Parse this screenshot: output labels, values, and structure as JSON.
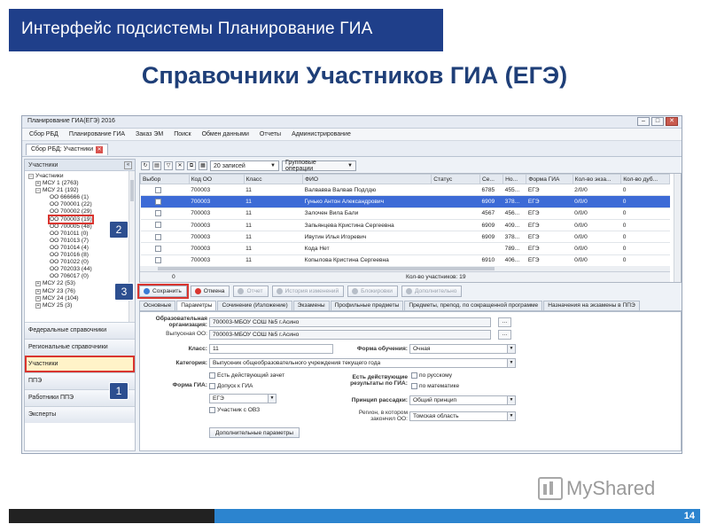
{
  "slide": {
    "banner": "Интерфейс подсистемы Планирование ГИА",
    "subtitle": "Справочники Участников ГИА (ЕГЭ)",
    "page_number": "14",
    "logo_text": "MyShared"
  },
  "window": {
    "title": "Планирование ГИА(ЕГЭ) 2016",
    "menu": [
      "Сбор РБД",
      "Планирование ГИА",
      "Заказ ЭМ",
      "Поиск",
      "Обмен данными",
      "Отчеты",
      "Администрирование"
    ],
    "doc_tab": "Сбор РБД: Участники"
  },
  "left_panel": {
    "header": "Участники",
    "tree": [
      {
        "label": "Участники",
        "level": 0,
        "exp": "−"
      },
      {
        "label": "МСУ 1 (2763)",
        "level": 1,
        "exp": "+"
      },
      {
        "label": "МСУ 21 (192)",
        "level": 1,
        "exp": "−"
      },
      {
        "label": "ОО 666666 (1)",
        "level": 2
      },
      {
        "label": "ОО 700001 (22)",
        "level": 2
      },
      {
        "label": "ОО 700002 (29)",
        "level": 2
      },
      {
        "label": "ОО 700003 (19)",
        "level": 2
      },
      {
        "label": "ОО 700005 (48)",
        "level": 2
      },
      {
        "label": "ОО 701011 (0)",
        "level": 2
      },
      {
        "label": "ОО 701013 (7)",
        "level": 2
      },
      {
        "label": "ОО 701014 (4)",
        "level": 2
      },
      {
        "label": "ОО 701016 (8)",
        "level": 2
      },
      {
        "label": "ОО 701022 (0)",
        "level": 2
      },
      {
        "label": "ОО 702033 (44)",
        "level": 2
      },
      {
        "label": "ОО 706017 (0)",
        "level": 2
      },
      {
        "label": "МСУ 22 (53)",
        "level": 1,
        "exp": "+"
      },
      {
        "label": "МСУ 23 (76)",
        "level": 1,
        "exp": "+"
      },
      {
        "label": "МСУ 24 (104)",
        "level": 1,
        "exp": "+"
      },
      {
        "label": "МСУ 25 (3)",
        "level": 1,
        "exp": "+"
      }
    ],
    "nav": [
      "Федеральные справочники",
      "Региональные справочники",
      "Участники",
      "ППЭ",
      "Работники ППЭ",
      "Эксперты"
    ]
  },
  "toolbar": {
    "records_combo": "20 записей",
    "group_ops": "Групповые операции"
  },
  "grid": {
    "columns": [
      "Выбор",
      "Код ОО",
      "Класс",
      "ФИО",
      "Статус",
      "Се...",
      "Но...",
      "Форма ГИА",
      "Кол-во экза...",
      "Кол-во дуб..."
    ],
    "rows": [
      [
        "",
        "700003",
        "11",
        "Валвавва Валвав Подлдю",
        "",
        "6785",
        "455...",
        "ЕГЭ",
        "2/0/0",
        "0"
      ],
      [
        "",
        "700003",
        "11",
        "Гунько Антон Александрович",
        "",
        "6909",
        "378...",
        "ЕГЭ",
        "0/0/0",
        "0"
      ],
      [
        "",
        "700003",
        "11",
        "Залочен Вила Бали",
        "",
        "4567",
        "456...",
        "ЕГЭ",
        "0/0/0",
        "0"
      ],
      [
        "",
        "700003",
        "11",
        "Запьянцева Кристина Сергеевна",
        "",
        "6909",
        "409...",
        "ЕГЭ",
        "0/0/0",
        "0"
      ],
      [
        "",
        "700003",
        "11",
        "Ивутин Илья Игоревич",
        "",
        "6909",
        "378...",
        "ЕГЭ",
        "0/0/0",
        "0"
      ],
      [
        "",
        "700003",
        "11",
        "Кода Нет",
        "",
        "",
        "789...",
        "ЕГЭ",
        "0/0/0",
        "0"
      ],
      [
        "",
        "700003",
        "11",
        "Копылова Кристина Сергеевна",
        "",
        "6910",
        "406...",
        "ЕГЭ",
        "0/0/0",
        "0"
      ]
    ],
    "footer_left": "0",
    "footer_count": "Кол-во участников: 19"
  },
  "actions": [
    {
      "label": "Сохранить",
      "enabled": true,
      "color": "#3a7bd5"
    },
    {
      "label": "Отмена",
      "enabled": true,
      "color": "#d9352f"
    },
    {
      "label": "Отчет",
      "enabled": false,
      "color": "#b7bec8"
    },
    {
      "label": "История изменений",
      "enabled": false,
      "color": "#b7bec8"
    },
    {
      "label": "Блокировки",
      "enabled": false,
      "color": "#b7bec8"
    },
    {
      "label": "Дополнительно",
      "enabled": false,
      "color": "#b7bec8"
    }
  ],
  "detail_tabs": [
    "Основные",
    "Параметры",
    "Сочинение (Изложение)",
    "Экзамены",
    "Профильные предметы",
    "Предметы, препод. по сокращенной программе",
    "Назначения на экзамены в ППЭ"
  ],
  "form": {
    "org_label": "Образовательная организация:",
    "org_value": "700003-МБОУ СОШ №5 г.Асино",
    "grad_label": "Выпускная ОО:",
    "grad_value": "700003-МБОУ СОШ №5 г.Асино",
    "class_label": "Класс:",
    "class_value": "11",
    "study_label": "Форма обучения:",
    "study_value": "Очная",
    "cat_label": "Категория:",
    "cat_value": "Выпускник общеобразовательного учреждения текущего года",
    "gia_label": "Форма ГИА:",
    "chk_zachet": "Есть действующий зачет",
    "chk_dopusk": "Допуск к ГИА",
    "gia_value": "ЕГЭ",
    "chk_ovz": "Участник с ОВЗ",
    "results_label": "Есть действующие результаты по ГИА:",
    "chk_rus": "по русскому",
    "chk_math": "по математике",
    "rassadka_label": "Принцип рассадки:",
    "rassadka_value": "Общий принцип",
    "region_label": "Регион, в котором закончил ОО:",
    "region_value": "Томская область",
    "extra_button": "Дополнительные параметры"
  },
  "badges": [
    "1",
    "2",
    "3"
  ]
}
